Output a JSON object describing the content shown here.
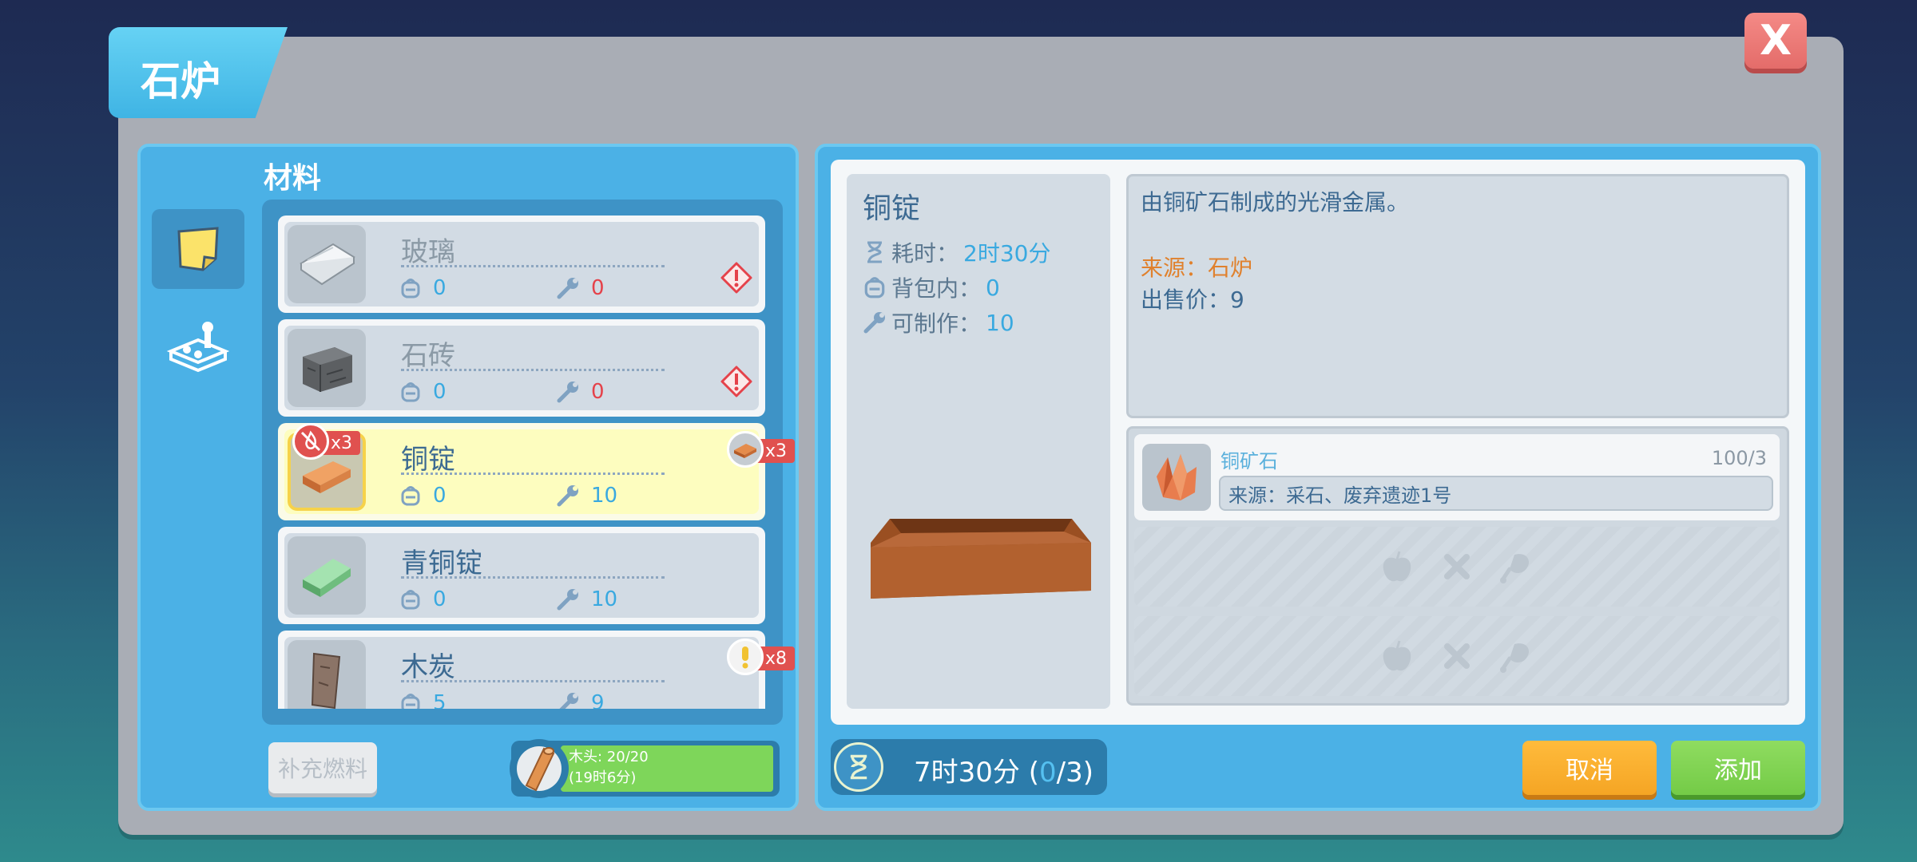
{
  "window": {
    "title": "石炉",
    "close_label": "X"
  },
  "left": {
    "section_label": "材料",
    "categories": [
      {
        "name": "notes",
        "icon": "sticky-note-icon",
        "selected": true
      },
      {
        "name": "machines",
        "icon": "machine-parts-icon",
        "selected": false
      }
    ],
    "items": [
      {
        "name": "玻璃",
        "bag": "0",
        "craftable": "0",
        "craftable_color": "red",
        "warning": true,
        "icon": "glass-icon"
      },
      {
        "name": "石砖",
        "bag": "0",
        "craftable": "0",
        "craftable_color": "red",
        "warning": true,
        "icon": "stone-brick-icon"
      },
      {
        "name": "铜锭",
        "bag": "0",
        "craftable": "10",
        "craftable_color": "blue",
        "selected": true,
        "badge_left": "x3",
        "badge_right": "x3",
        "icon": "copper-ingot-icon"
      },
      {
        "name": "青铜锭",
        "bag": "0",
        "craftable": "10",
        "craftable_color": "blue",
        "icon": "bronze-ingot-icon"
      },
      {
        "name": "木炭",
        "bag": "5",
        "craftable": "9",
        "craftable_color": "blue",
        "badge_right": "x8",
        "icon": "charcoal-icon"
      }
    ],
    "fuel_button": "补充燃料",
    "fuel": {
      "line1": "木头: 20/20",
      "line2": "(19时6分)",
      "level": 1.0
    }
  },
  "detail": {
    "name": "铜锭",
    "time_label": "耗时：",
    "time_value": "2时30分",
    "bag_label": "背包内：",
    "bag_value": "0",
    "craftable_label": "可制作：",
    "craftable_value": "10",
    "description": "由铜矿石制成的光滑金属。",
    "source": "来源：石炉",
    "price": "出售价：9",
    "materials": [
      {
        "name": "铜矿石",
        "count": "100/3",
        "source": "来源：采石、废弃遗迹1号",
        "icon": "copper-ore-icon"
      }
    ],
    "empty_slots": 2
  },
  "footer": {
    "timer_main": "7时30分 (",
    "timer_current": "0",
    "timer_rest": "/3)",
    "cancel_label": "取消",
    "add_label": "添加"
  },
  "colors": {
    "panel_blue": "#4bb1e6",
    "warning_red": "#e5424a",
    "source_orange": "#e0812d",
    "cancel_orange": "#f5a524",
    "add_green": "#74cb47",
    "selected_yellow": "#fdfdbf"
  }
}
